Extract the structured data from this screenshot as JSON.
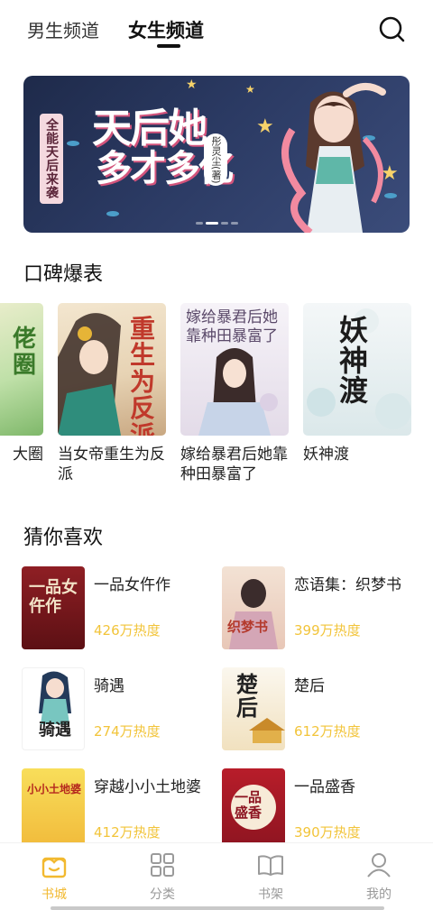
{
  "header": {
    "tabs": [
      {
        "label": "男生频道",
        "active": false
      },
      {
        "label": "女生频道",
        "active": true
      }
    ]
  },
  "banner": {
    "badge": "全能天后来袭",
    "title_line1": "天后她",
    "title_line2": "多才多亿",
    "author": "彤灵尘(著)"
  },
  "section1": {
    "title": "口碑爆表",
    "books": [
      {
        "title": "大圈",
        "cover_text": "佬圈",
        "partial": true
      },
      {
        "title": "当女帝重生为反派",
        "cover_text": "重生为反派"
      },
      {
        "title": "嫁给暴君后她靠种田暴富了",
        "cover_text": "嫁给暴君后她靠种田暴富了"
      },
      {
        "title": "妖神渡",
        "cover_text": "妖神渡"
      }
    ]
  },
  "section2": {
    "title": "猜你喜欢",
    "books": [
      {
        "title": "一品女仵作",
        "heat": "426万热度",
        "cover_text": "一品女仵作"
      },
      {
        "title": "恋语集：织梦书",
        "heat": "399万热度",
        "cover_text": "织梦书"
      },
      {
        "title": "骑遇",
        "heat": "274万热度",
        "cover_text": "骑遇"
      },
      {
        "title": "楚后",
        "heat": "612万热度",
        "cover_text": "楚后"
      },
      {
        "title": "穿越小小土地婆",
        "heat": "412万热度",
        "cover_text": "小小土地婆"
      },
      {
        "title": "一品盛香",
        "heat": "390万热度",
        "cover_text": "一品盛香"
      }
    ]
  },
  "nav": {
    "items": [
      {
        "label": "书城",
        "icon": "bookstore-icon",
        "active": true
      },
      {
        "label": "分类",
        "icon": "category-icon",
        "active": false
      },
      {
        "label": "书架",
        "icon": "bookshelf-icon",
        "active": false
      },
      {
        "label": "我的",
        "icon": "profile-icon",
        "active": false
      }
    ]
  },
  "colors": {
    "accent": "#f2b930",
    "heat": "#f2c43a",
    "banner_bg": "#2b3a63"
  }
}
